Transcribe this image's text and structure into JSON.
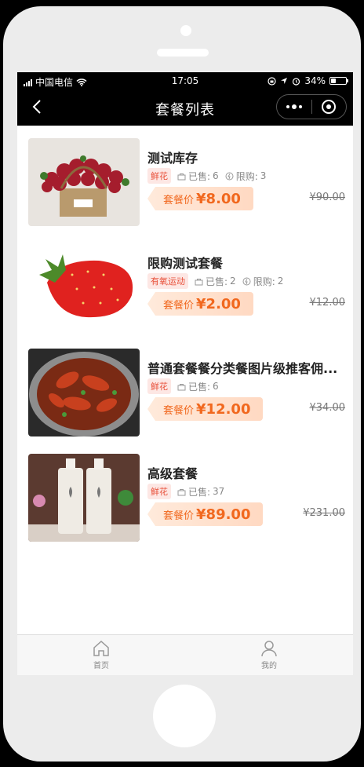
{
  "status": {
    "carrier": "中国电信",
    "time": "17:05",
    "battery": "34%",
    "battery_level": 0.34
  },
  "nav": {
    "title": "套餐列表"
  },
  "items": [
    {
      "name": "测试库存",
      "tag": "鲜花",
      "sold_label": "已售:",
      "sold": "6",
      "limit_label": "限购:",
      "limit": "3",
      "price_label": "套餐价",
      "price": "¥8.00",
      "original": "¥90.00",
      "image": "rose-basket"
    },
    {
      "name": "限购测试套餐",
      "tag": "有氧运动",
      "sold_label": "已售:",
      "sold": "2",
      "limit_label": "限购:",
      "limit": "2",
      "price_label": "套餐价",
      "price": "¥2.00",
      "original": "¥12.00",
      "image": "strawberry"
    },
    {
      "name": "普通套餐餐分类餐图片级推客佣...",
      "tag": "鲜花",
      "sold_label": "已售:",
      "sold": "6",
      "price_label": "套餐价",
      "price": "¥12.00",
      "original": "¥34.00",
      "image": "crayfish"
    },
    {
      "name": "高级套餐",
      "tag": "鲜花",
      "sold_label": "已售:",
      "sold": "37",
      "price_label": "套餐价",
      "price": "¥89.00",
      "original": "¥231.00",
      "image": "lotion-bottles"
    }
  ],
  "tabbar": {
    "home": "首页",
    "mine": "我的"
  }
}
